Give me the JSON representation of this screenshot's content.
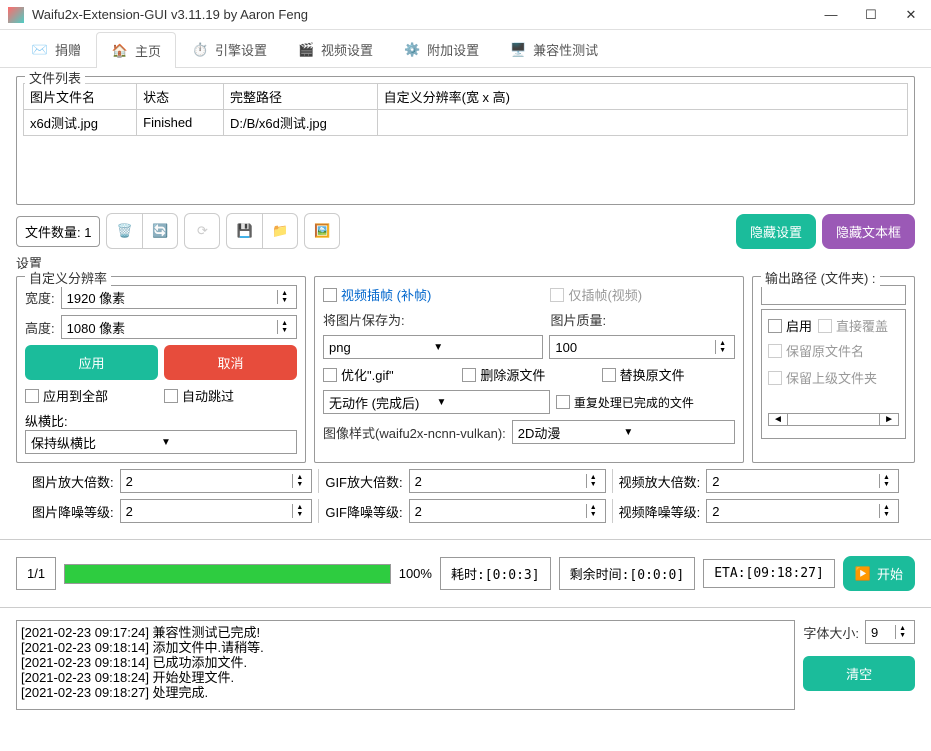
{
  "titlebar": {
    "text": "Waifu2x-Extension-GUI v3.11.19 by Aaron Feng"
  },
  "tabs": {
    "donate": "捐赠",
    "home": "主页",
    "engine": "引擎设置",
    "video": "视频设置",
    "additional": "附加设置",
    "compat": "兼容性测试"
  },
  "fileList": {
    "title": "文件列表",
    "headers": {
      "name": "图片文件名",
      "status": "状态",
      "path": "完整路径",
      "res": "自定义分辨率(宽 x 高)"
    },
    "rows": [
      {
        "name": "x6d测试.jpg",
        "status": "Finished",
        "path": "D:/B/x6d测试.jpg",
        "res": ""
      }
    ]
  },
  "fileCount": {
    "label": "文件数量: 1"
  },
  "hideSettings": "隐藏设置",
  "hideTextbox": "隐藏文本框",
  "settingsLabel": "设置",
  "resolution": {
    "title": "自定义分辨率",
    "width_label": "宽度:",
    "width_value": "1920 像素",
    "height_label": "高度:",
    "height_value": "1080 像素",
    "apply": "应用",
    "cancel": "取消",
    "applyAll": "应用到全部",
    "autoSkip": "自动跳过",
    "aspect_label": "纵横比:",
    "aspect_value": "保持纵横比"
  },
  "mid": {
    "videoInterp": "视频插帧 (补帧)",
    "onlyInterp": "仅插帧(视频)",
    "saveAs_label": "将图片保存为:",
    "saveAs_value": "png",
    "quality_label": "图片质量:",
    "quality_value": "100",
    "optimizeGif": "优化\".gif\"",
    "deleteSrc": "删除源文件",
    "replaceSrc": "替换原文件",
    "afterDone_value": "无动作 (完成后)",
    "reprocess": "重复处理已完成的文件",
    "style_label": "图像样式(waifu2x-ncnn-vulkan):",
    "style_value": "2D动漫"
  },
  "output": {
    "title": "输出路径 (文件夹) :",
    "enable": "启用",
    "overwrite": "直接覆盖",
    "keepName": "保留原文件名",
    "keepPath": "保留上级文件夹"
  },
  "scale": {
    "imgScale": "图片放大倍数:",
    "imgDenoise": "图片降噪等级:",
    "gifScale": "GIF放大倍数:",
    "gifDenoise": "GIF降噪等级:",
    "vidScale": "视频放大倍数:",
    "vidDenoise": "视频降噪等级:",
    "value": "2"
  },
  "progress": {
    "fraction": "1/1",
    "percent": "100%",
    "elapsed": "耗时:[0:0:3]",
    "remaining": "剩余时间:[0:0:0]",
    "eta": "ETA:[09:18:27]",
    "start": "开始"
  },
  "log": {
    "lines": [
      "[2021-02-23 09:17:24] 兼容性测试已完成!",
      "[2021-02-23 09:18:14] 添加文件中.请稍等.",
      "[2021-02-23 09:18:14] 已成功添加文件.",
      "[2021-02-23 09:18:24] 开始处理文件.",
      "[2021-02-23 09:18:27] 处理完成."
    ],
    "fontSize_label": "字体大小:",
    "fontSize_value": "9",
    "clear": "清空"
  }
}
